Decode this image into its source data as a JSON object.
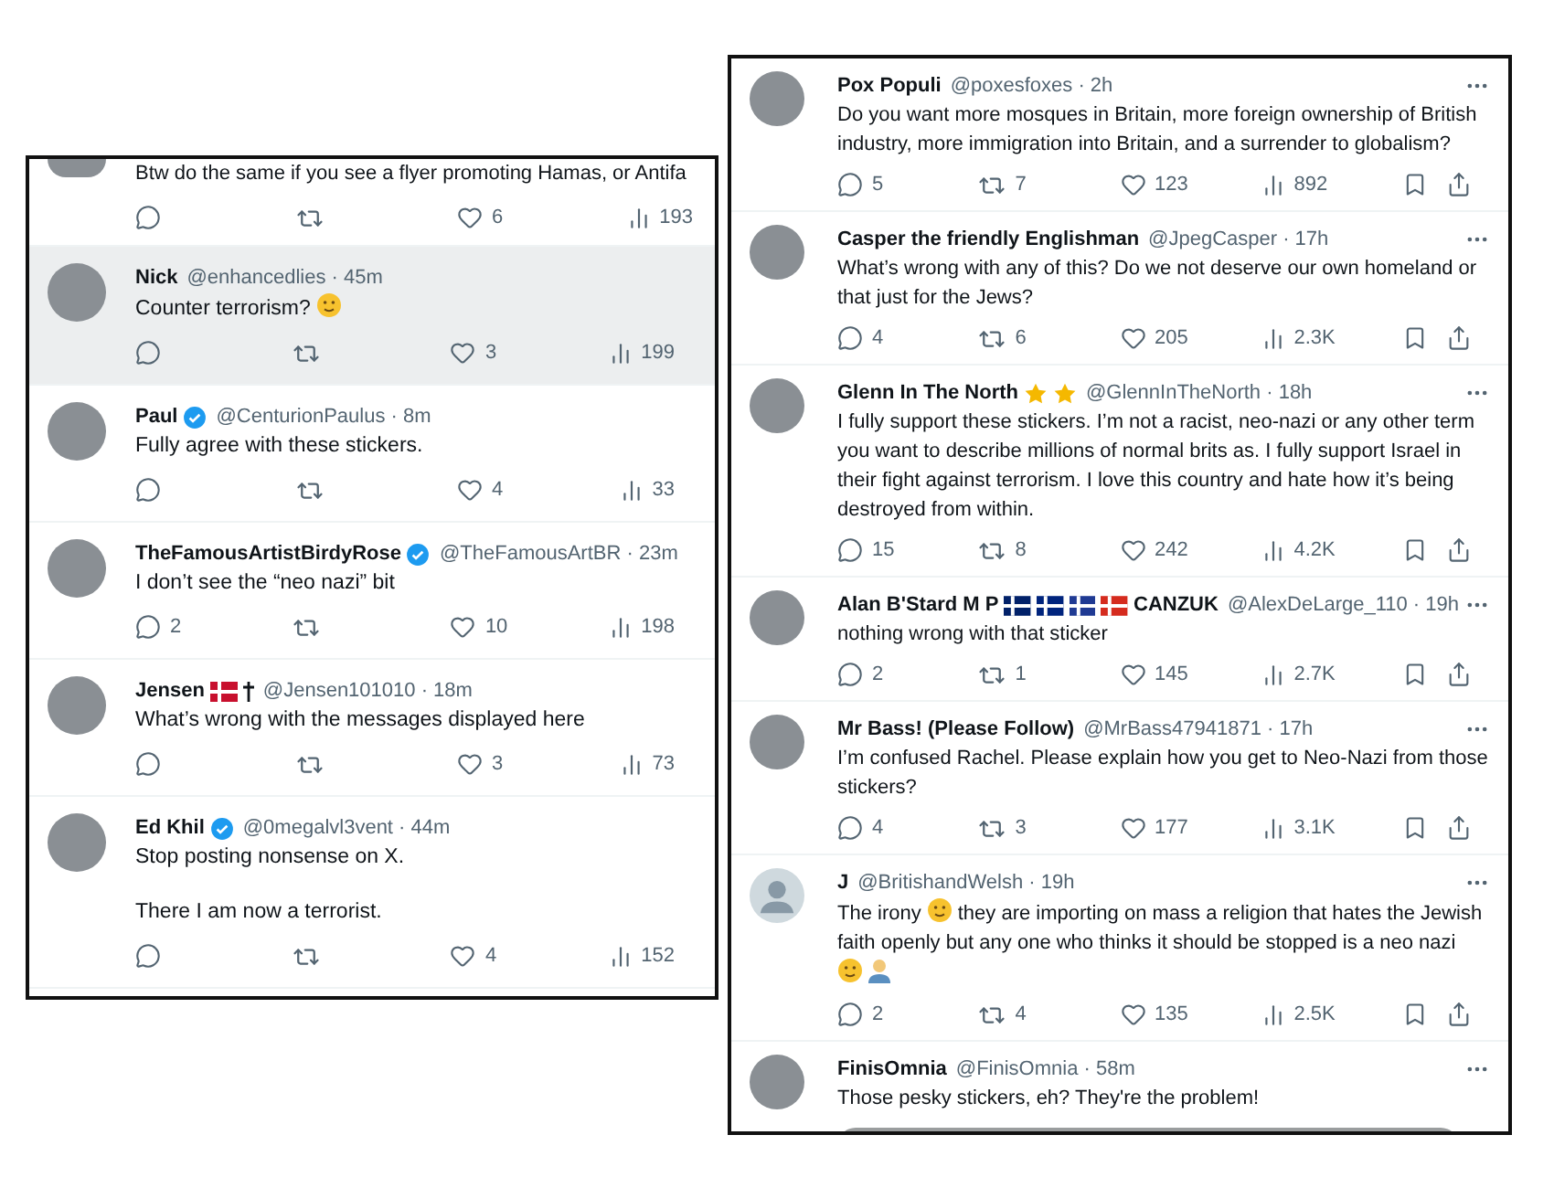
{
  "left_panel": {
    "posts": [
      {
        "partial": true,
        "hovered": false,
        "body": [
          [
            {
              "kind": "text",
              "text": "Btw do the same if you see a flyer promoting Hamas, or Antifa"
            }
          ]
        ],
        "actions": [
          {
            "kind": "reply"
          },
          {
            "kind": "repost"
          },
          {
            "kind": "like",
            "count": "6"
          },
          {
            "kind": "views",
            "count": "193"
          }
        ]
      },
      {
        "hovered": true,
        "default_avatar": false,
        "name": [
          {
            "kind": "text",
            "text": "Nick"
          }
        ],
        "meta": "@enhancedlies · 45m",
        "body": [
          [
            {
              "kind": "text",
              "text": "Counter terrorism?"
            },
            {
              "kind": "face"
            }
          ]
        ],
        "actions": [
          {
            "kind": "reply"
          },
          {
            "kind": "repost"
          },
          {
            "kind": "like",
            "count": "3"
          },
          {
            "kind": "views",
            "count": "199"
          }
        ]
      },
      {
        "hovered": false,
        "default_avatar": false,
        "name": [
          {
            "kind": "text",
            "text": "Paul"
          },
          {
            "kind": "verified"
          }
        ],
        "meta": "@CenturionPaulus · 8m",
        "body": [
          [
            {
              "kind": "text",
              "text": "Fully agree with these stickers."
            }
          ]
        ],
        "actions": [
          {
            "kind": "reply"
          },
          {
            "kind": "repost"
          },
          {
            "kind": "like",
            "count": "4"
          },
          {
            "kind": "views",
            "count": "33"
          }
        ]
      },
      {
        "hovered": false,
        "default_avatar": false,
        "name": [
          {
            "kind": "text",
            "text": "TheFamousArtistBirdyRose"
          },
          {
            "kind": "verified"
          }
        ],
        "meta": "@TheFamousArtBR · 23m",
        "body": [
          [
            {
              "kind": "text",
              "text": "I don’t see the “neo nazi” bit"
            }
          ]
        ],
        "actions": [
          {
            "kind": "reply",
            "count": "2"
          },
          {
            "kind": "repost"
          },
          {
            "kind": "like",
            "count": "10"
          },
          {
            "kind": "views",
            "count": "198"
          }
        ]
      },
      {
        "hovered": false,
        "default_avatar": false,
        "name": [
          {
            "kind": "text",
            "text": "Jensen"
          },
          {
            "kind": "flag",
            "color": "#c8102e"
          },
          {
            "kind": "cross"
          }
        ],
        "meta": "@Jensen101010 · 18m",
        "body": [
          [
            {
              "kind": "text",
              "text": "What’s wrong with the messages displayed here"
            }
          ]
        ],
        "actions": [
          {
            "kind": "reply"
          },
          {
            "kind": "repost"
          },
          {
            "kind": "like",
            "count": "3"
          },
          {
            "kind": "views",
            "count": "73"
          }
        ]
      },
      {
        "hovered": false,
        "default_avatar": false,
        "name": [
          {
            "kind": "text",
            "text": "Ed Khil"
          },
          {
            "kind": "verified"
          }
        ],
        "meta": "@0megalvl3vent · 44m",
        "body": [
          [
            {
              "kind": "text",
              "text": "Stop posting nonsense on X."
            }
          ],
          [
            {
              "kind": "text",
              "text": "There I am now a terrorist."
            }
          ]
        ],
        "actions": [
          {
            "kind": "reply"
          },
          {
            "kind": "repost"
          },
          {
            "kind": "like",
            "count": "4"
          },
          {
            "kind": "views",
            "count": "152"
          }
        ]
      }
    ]
  },
  "right_panel": {
    "posts": [
      {
        "default_avatar": false,
        "more": true,
        "name": [
          {
            "kind": "text",
            "text": "Pox Populi"
          }
        ],
        "meta": "@poxesfoxes · 2h",
        "body": [
          [
            {
              "kind": "text",
              "text": "Do you want more mosques in Britain, more foreign ownership of British industry, more immigration into Britain, and a surrender to globalism?"
            }
          ]
        ],
        "actions": [
          {
            "kind": "reply",
            "count": "5"
          },
          {
            "kind": "repost",
            "count": "7"
          },
          {
            "kind": "like",
            "count": "123"
          },
          {
            "kind": "views",
            "count": "892"
          },
          {
            "kind": "bookmark"
          },
          {
            "kind": "share"
          }
        ]
      },
      {
        "default_avatar": false,
        "more": true,
        "name": [
          {
            "kind": "text",
            "text": "Casper the friendly Englishman"
          }
        ],
        "meta": "@JpegCasper · 17h",
        "body": [
          [
            {
              "kind": "text",
              "text": "What’s wrong with any of this? Do we not deserve our own homeland or that just for the Jews?"
            }
          ]
        ],
        "actions": [
          {
            "kind": "reply",
            "count": "4"
          },
          {
            "kind": "repost",
            "count": "6"
          },
          {
            "kind": "like",
            "count": "205"
          },
          {
            "kind": "views",
            "count": "2.3K"
          },
          {
            "kind": "bookmark"
          },
          {
            "kind": "share"
          }
        ]
      },
      {
        "default_avatar": false,
        "more": true,
        "name": [
          {
            "kind": "text",
            "text": "Glenn In The North"
          },
          {
            "kind": "star"
          },
          {
            "kind": "star"
          }
        ],
        "meta": "@GlennInTheNorth · 18h",
        "body": [
          [
            {
              "kind": "text",
              "text": "I fully support these stickers. I’m not a racist, neo-nazi or any other term you want to describe millions of normal brits as. I fully support Israel in their fight against terrorism. I love this country and hate how it’s being destroyed from within."
            }
          ]
        ],
        "actions": [
          {
            "kind": "reply",
            "count": "15"
          },
          {
            "kind": "repost",
            "count": "8"
          },
          {
            "kind": "like",
            "count": "242"
          },
          {
            "kind": "views",
            "count": "4.2K"
          },
          {
            "kind": "bookmark"
          },
          {
            "kind": "share"
          }
        ]
      },
      {
        "default_avatar": false,
        "more": true,
        "name": [
          {
            "kind": "text",
            "text": "Alan B'Stard M P"
          },
          {
            "kind": "flag",
            "color": "#012169"
          },
          {
            "kind": "flag",
            "color": "#00247d"
          },
          {
            "kind": "flag",
            "color": "#1f3a93"
          },
          {
            "kind": "flag",
            "color": "#d52b1e"
          },
          {
            "kind": "text",
            "text": "CANZUK"
          }
        ],
        "meta": "@AlexDeLarge_110 · 19h",
        "body": [
          [
            {
              "kind": "text",
              "text": "nothing wrong with that sticker"
            }
          ]
        ],
        "actions": [
          {
            "kind": "reply",
            "count": "2"
          },
          {
            "kind": "repost",
            "count": "1"
          },
          {
            "kind": "like",
            "count": "145"
          },
          {
            "kind": "views",
            "count": "2.7K"
          },
          {
            "kind": "bookmark"
          },
          {
            "kind": "share"
          }
        ]
      },
      {
        "default_avatar": false,
        "more": true,
        "name": [
          {
            "kind": "text",
            "text": "Mr Bass! (Please Follow)"
          }
        ],
        "meta": "@MrBass47941871 · 17h",
        "body": [
          [
            {
              "kind": "text",
              "text": "I’m confused Rachel. Please explain how you get to Neo-Nazi from those stickers?"
            }
          ]
        ],
        "actions": [
          {
            "kind": "reply",
            "count": "4"
          },
          {
            "kind": "repost",
            "count": "3"
          },
          {
            "kind": "like",
            "count": "177"
          },
          {
            "kind": "views",
            "count": "3.1K"
          },
          {
            "kind": "bookmark"
          },
          {
            "kind": "share"
          }
        ]
      },
      {
        "default_avatar": true,
        "more": true,
        "name": [
          {
            "kind": "text",
            "text": "J"
          }
        ],
        "meta": "@BritishandWelsh · 19h",
        "body": [
          [
            {
              "kind": "text",
              "text": "The irony"
            },
            {
              "kind": "face"
            },
            {
              "kind": "text",
              "text": "they are importing on mass a religion that hates the Jewish faith openly but any one who thinks it should be stopped is a neo nazi"
            },
            {
              "kind": "face"
            },
            {
              "kind": "person"
            }
          ]
        ],
        "actions": [
          {
            "kind": "reply",
            "count": "2"
          },
          {
            "kind": "repost",
            "count": "4"
          },
          {
            "kind": "like",
            "count": "135"
          },
          {
            "kind": "views",
            "count": "2.5K"
          },
          {
            "kind": "bookmark"
          },
          {
            "kind": "share"
          }
        ]
      },
      {
        "default_avatar": false,
        "more": true,
        "media": true,
        "name": [
          {
            "kind": "text",
            "text": "FinisOmnia"
          }
        ],
        "meta": "@FinisOmnia · 58m",
        "body": [
          [
            {
              "kind": "text",
              "text": "Those pesky stickers, eh? They're the problem!"
            }
          ]
        ]
      }
    ]
  }
}
